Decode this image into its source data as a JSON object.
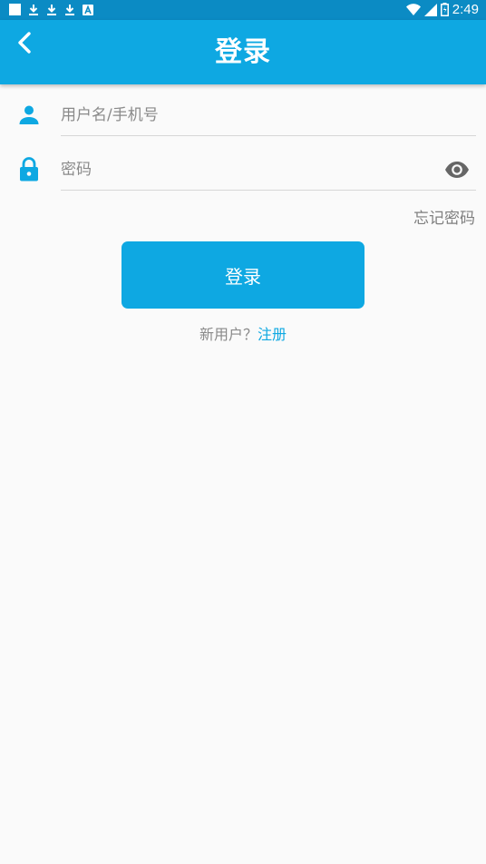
{
  "status_bar": {
    "time": "2:49",
    "icons": [
      "notification-square-icon",
      "download-icon",
      "download-icon",
      "download-icon",
      "app-a-icon",
      "wifi-icon",
      "signal-icon",
      "battery-icon"
    ]
  },
  "header": {
    "title": "登录",
    "back_icon": "chevron-left-icon"
  },
  "form": {
    "username_placeholder": "用户名/手机号",
    "password_placeholder": "密码",
    "forgot_password": "忘记密码",
    "login_button": "登录",
    "new_user_prompt": "新用户？",
    "register_link": "注册"
  },
  "colors": {
    "primary": "#0ea8e2",
    "status_bar": "#0b8bc4",
    "background": "#fafafa",
    "hint_text": "#8a8a8a"
  }
}
